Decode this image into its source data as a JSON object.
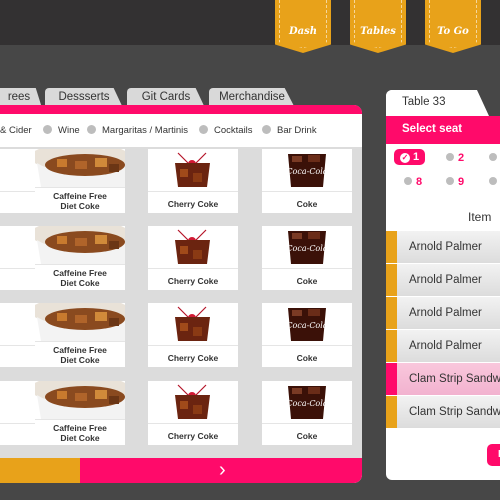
{
  "nav": {
    "ribbons": [
      {
        "label": "Dash"
      },
      {
        "label": "Tables"
      },
      {
        "label": "To Go"
      }
    ],
    "accent_orange": "#e8a21a",
    "accent_pink": "#ff0a6a"
  },
  "menu": {
    "tabs": [
      {
        "label": "rees"
      },
      {
        "label": "Dessserts"
      },
      {
        "label": "Git Cards"
      },
      {
        "label": "Merchandise"
      }
    ],
    "categories": [
      {
        "label": "& Cider"
      },
      {
        "label": "Wine"
      },
      {
        "label": "Margaritas / Martinis"
      },
      {
        "label": "Cocktails"
      },
      {
        "label": "Bar Drink"
      }
    ],
    "items": [
      {
        "name": "Caffeine Free Diet Coke",
        "line1": "Caffeine Free",
        "line2": "Diet Coke"
      },
      {
        "name": "Cherry Coke"
      },
      {
        "name": "Coke"
      }
    ],
    "next_label": "›"
  },
  "order": {
    "table_label": "Table 33",
    "select_seat_label": "Select seat",
    "seats": [
      {
        "label": "1",
        "active": true
      },
      {
        "label": "2"
      },
      {
        "label": "8"
      },
      {
        "label": "9"
      }
    ],
    "item_header": "Item",
    "rows": [
      {
        "label": "Arnold Palmer"
      },
      {
        "label": "Arnold Palmer"
      },
      {
        "label": "Arnold Palmer"
      },
      {
        "label": "Arnold Palmer"
      },
      {
        "label": "Clam Strip Sandw",
        "selected": true
      },
      {
        "label": "Clam Strip Sandw"
      }
    ],
    "action_button_label": "F"
  }
}
